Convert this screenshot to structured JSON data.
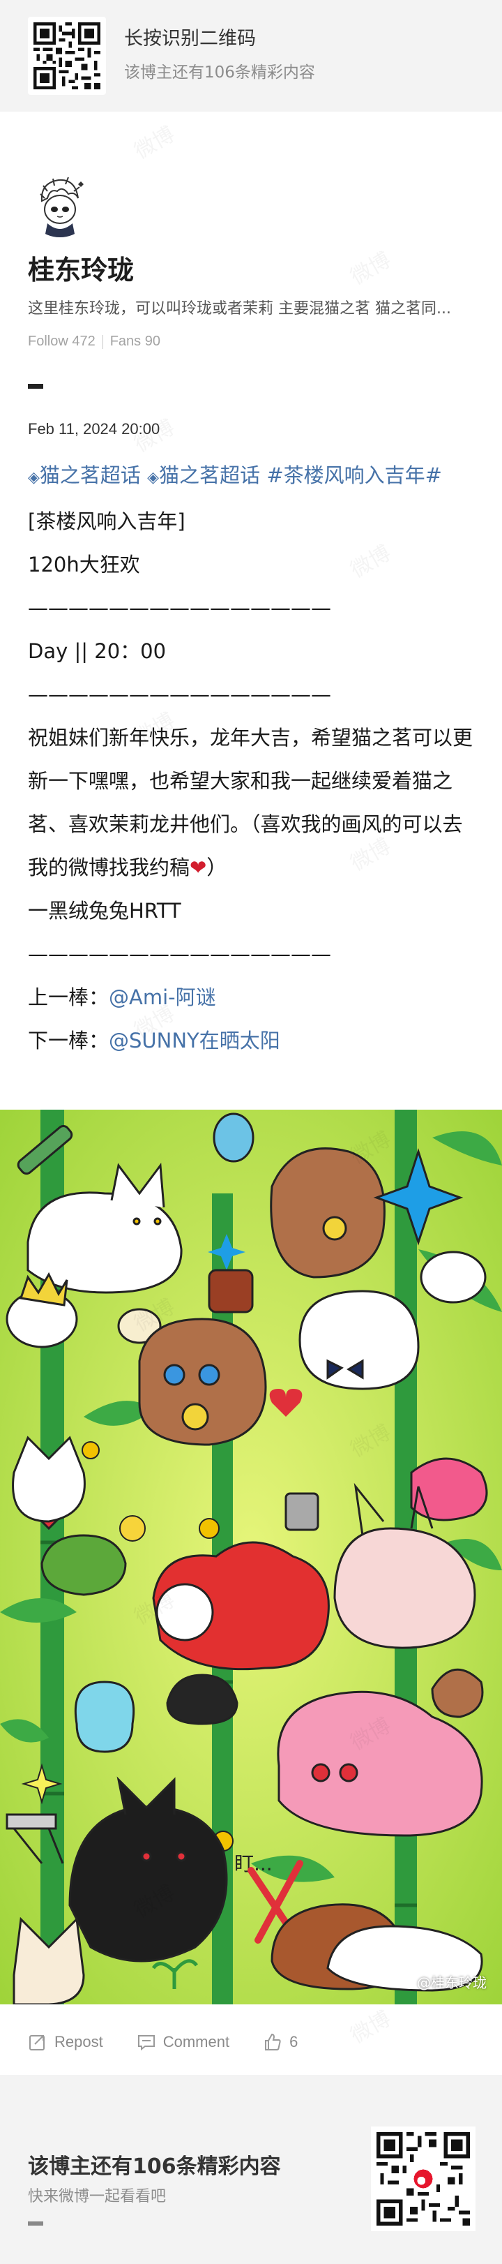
{
  "banner": {
    "title": "长按识别二维码",
    "subtitle": "该博主还有106条精彩内容"
  },
  "profile": {
    "username": "桂东玲珑",
    "bio": "这里桂东玲珑，可以叫玲珑或者茉莉 主要混猫之茗 猫之茗同...",
    "follow": "Follow 472",
    "fans": "Fans 90"
  },
  "post": {
    "date": "Feb 11, 2024 20:00",
    "topic1": "猫之茗超话",
    "topic2": "猫之茗超话",
    "hashtag": "#茶楼风响入吉年#",
    "line1": "[茶楼风响入吉年]",
    "line2": "120h大狂欢",
    "divider1": "———————————————",
    "line3": "Day || 20：00",
    "divider2": "———————————————",
    "para": "祝姐妹们新年快乐，龙年大吉，希望猫之茗可以更新一下嘿嘿，也希望大家和我一起继续爱着猫之茗、喜欢茉莉龙井他们。（喜欢我的画风的可以去我的微博找我约稿",
    "para_end": "）",
    "heart": "❤",
    "line4": "一黑绒兔兔HRTT",
    "divider3": "———————————————",
    "prev_label": "上一棒：",
    "prev_user": "@Ami-阿谜",
    "next_label": "下一棒：",
    "next_user": "@SUNNY在晒太阳",
    "image_watermark": "@桂东玲珑",
    "image_text": "盯..."
  },
  "actions": {
    "repost": "Repost",
    "comment": "Comment",
    "likes": "6"
  },
  "promo": {
    "title": "该博主还有106条精彩内容",
    "subtitle": "快来微博一起看看吧"
  },
  "watermark_text": "微博",
  "colors": {
    "link": "#4672a8",
    "art_background": "#9fd43a",
    "bamboo": "#2f9a3d"
  }
}
